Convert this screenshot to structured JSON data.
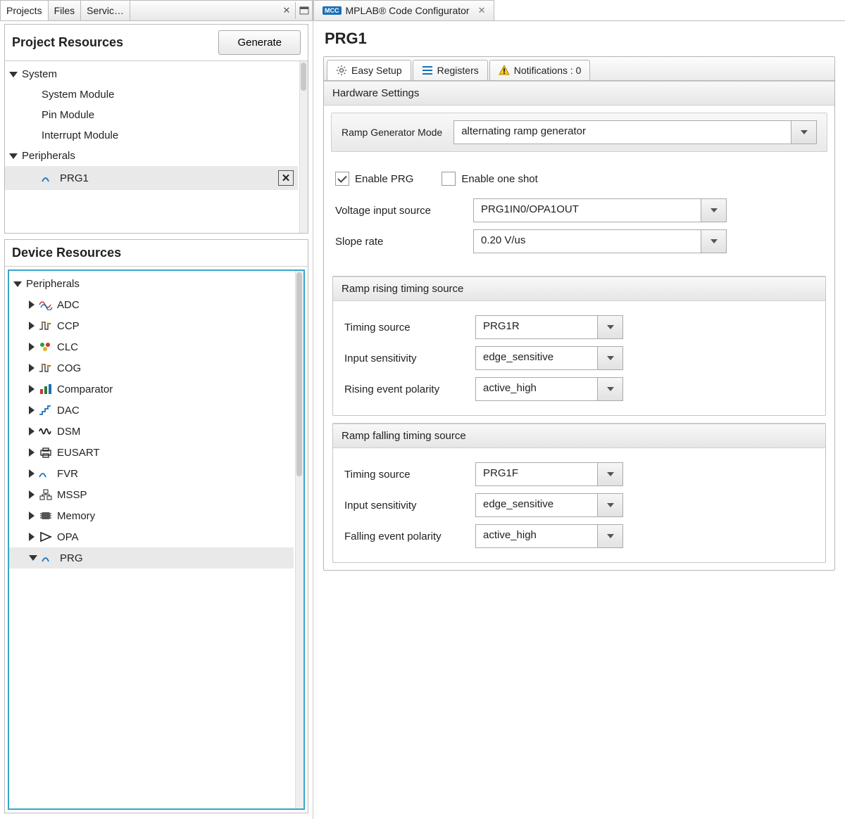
{
  "leftTabs": {
    "projects": "Projects",
    "files": "Files",
    "services": "Servic…"
  },
  "projectResources": {
    "title": "Project Resources",
    "generate": "Generate",
    "systemLabel": "System",
    "items": [
      "System Module",
      "Pin Module",
      "Interrupt Module"
    ],
    "peripheralsLabel": "Peripherals",
    "selected": "PRG1"
  },
  "deviceResources": {
    "title": "Device Resources",
    "peripheralsLabel": "Peripherals",
    "items": [
      {
        "name": "ADC"
      },
      {
        "name": "CCP"
      },
      {
        "name": "CLC"
      },
      {
        "name": "COG"
      },
      {
        "name": "Comparator"
      },
      {
        "name": "DAC"
      },
      {
        "name": "DSM"
      },
      {
        "name": "EUSART"
      },
      {
        "name": "FVR"
      },
      {
        "name": "MSSP"
      },
      {
        "name": "Memory"
      },
      {
        "name": "OPA"
      },
      {
        "name": "PRG",
        "expanded": true
      }
    ]
  },
  "mainTab": {
    "badge": "MCC",
    "label": "MPLAB® Code Configurator"
  },
  "main": {
    "title": "PRG1",
    "tabs": {
      "easy": "Easy Setup",
      "registers": "Registers",
      "notifications": "Notifications : 0"
    },
    "hardwareSettings": "Hardware Settings",
    "rampModeLabel": "Ramp Generator Mode",
    "rampModeValue": "alternating ramp generator",
    "enablePrg": "Enable PRG",
    "enableOneShot": "Enable one shot",
    "voltageLabel": "Voltage input source",
    "voltageValue": "PRG1IN0/OPA1OUT",
    "slopeLabel": "Slope rate",
    "slopeValue": "0.20 V/us",
    "rising": {
      "header": "Ramp rising timing source",
      "timingLabel": "Timing source",
      "timingValue": "PRG1R",
      "sensLabel": "Input sensitivity",
      "sensValue": "edge_sensitive",
      "polLabel": "Rising event polarity",
      "polValue": "active_high"
    },
    "falling": {
      "header": "Ramp falling timing source",
      "timingLabel": "Timing source",
      "timingValue": "PRG1F",
      "sensLabel": "Input sensitivity",
      "sensValue": "edge_sensitive",
      "polLabel": "Falling event polarity",
      "polValue": "active_high"
    }
  }
}
